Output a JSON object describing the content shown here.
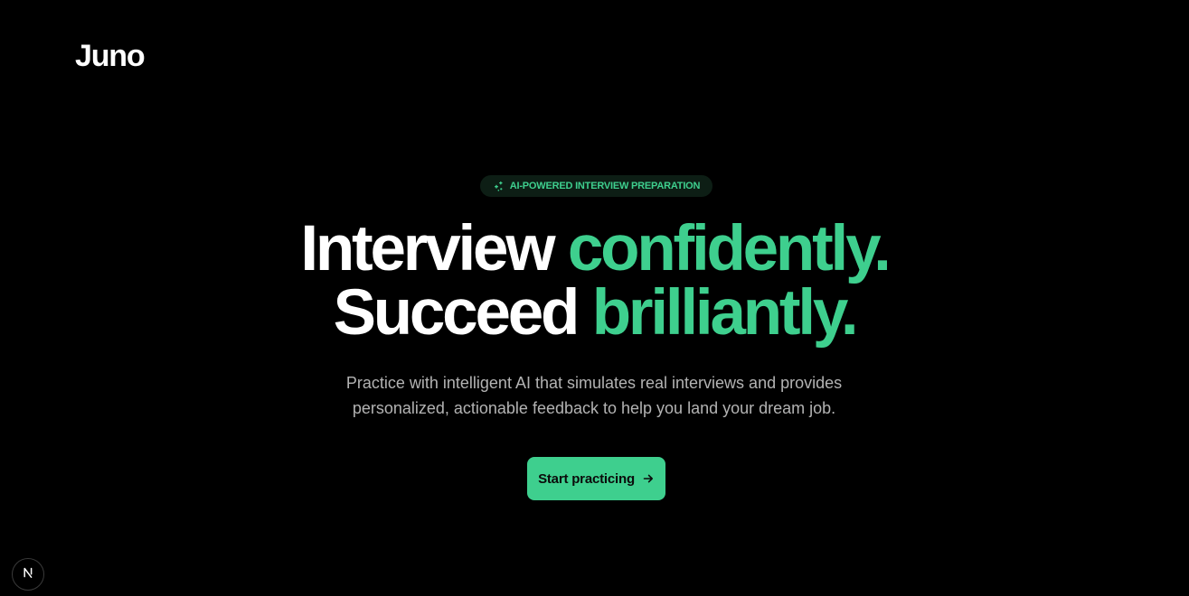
{
  "header": {
    "logo_text": "Juno"
  },
  "hero": {
    "badge": {
      "icon": "sparkles-icon",
      "text": "AI-POWERED INTERVIEW PREPARATION"
    },
    "headline": {
      "line1_plain": "Interview ",
      "line1_accent": "confidently.",
      "line2_plain": "Succeed ",
      "line2_accent": "brilliantly."
    },
    "subtitle": {
      "line1": "Practice with intelligent AI that simulates real interviews and provides",
      "line2": "personalized, actionable feedback to help you land your dream job."
    },
    "cta": {
      "label": "Start practicing",
      "icon": "arrow-right-icon"
    }
  },
  "dev_indicator": {
    "icon": "nextjs-logo-icon",
    "letter": "N"
  },
  "colors": {
    "background": "#000000",
    "accent": "#3ecf8e",
    "badge_background": "#0d1e15",
    "text_primary": "#ffffff",
    "text_muted": "#b3b3b3"
  }
}
